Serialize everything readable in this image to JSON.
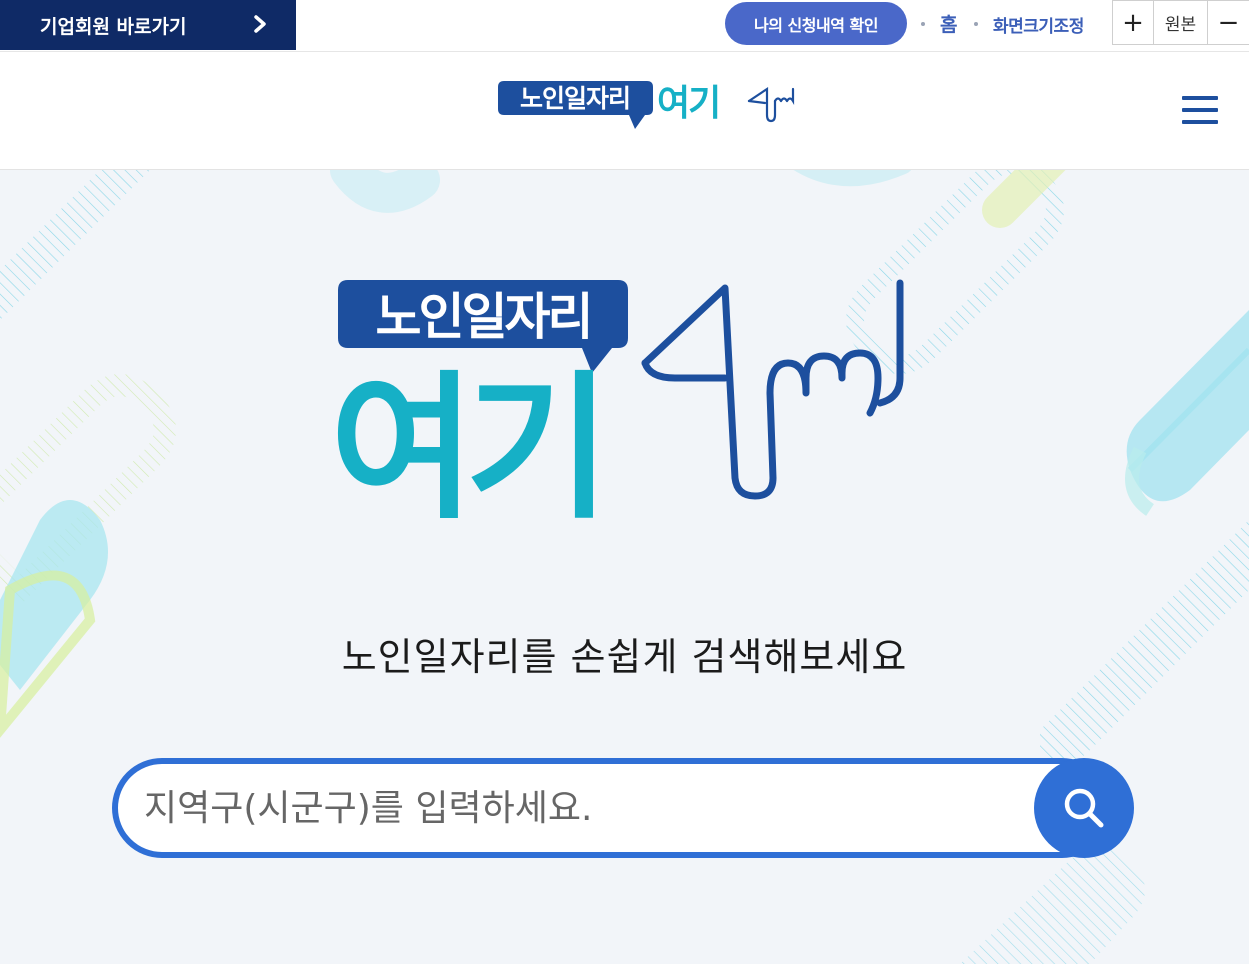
{
  "topbar": {
    "corp_link_label": "기업회원 바로가기",
    "apply_button_label": "나의 신청내역 확인",
    "home_label": "홈",
    "zoom_label": "화면크기조정",
    "zoom_in_symbol": "+",
    "zoom_reset_label": "원본",
    "zoom_out_symbol": "−"
  },
  "header": {
    "logo_text_top": "노인일자리",
    "logo_text_bottom": "여기",
    "logo_icon": "pointing-hand-icon",
    "menu_icon": "hamburger-menu-icon"
  },
  "hero": {
    "logo_text_top": "노인일자리",
    "logo_text_bottom": "여기",
    "tagline": "노인일자리를 손쉽게 검색해보세요"
  },
  "search": {
    "placeholder": "지역구(시군구)를 입력하세요.",
    "value": "",
    "button_icon": "search-icon"
  },
  "colors": {
    "navy": "#0f2a66",
    "accent_blue": "#2f6fd6",
    "logo_blue": "#1d4f9e",
    "logo_teal": "#16b0c6",
    "apply_button": "#4a68c9",
    "link_blue": "#3c5fb8"
  }
}
